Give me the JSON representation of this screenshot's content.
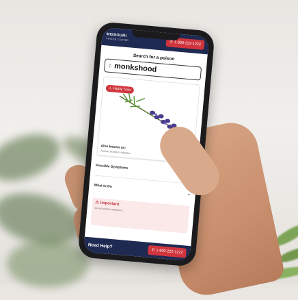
{
  "header": {
    "logo_text": "MISSOURI",
    "logo_sub": "POISON CENTER",
    "phone_label": "1-800-222-1222"
  },
  "search": {
    "title": "Search for a poison",
    "query": "monkshood"
  },
  "result": {
    "badge": "Highly Toxic",
    "also_known_as_label": "Also known as:",
    "also_known_as_value": "Aconite, Aconitum Napellus"
  },
  "sections": [
    {
      "label": "Possible Symptoms"
    },
    {
      "label": "What to Do"
    }
  ],
  "important": {
    "title": "Important",
    "body": "Do not wait for symptoms..."
  },
  "footer": {
    "need_help": "Need Help?",
    "phone_label": "1-800-222-1222"
  },
  "colors": {
    "navy": "#1f2a52",
    "red": "#d0353d",
    "plant_purple": "#4a3e8c"
  },
  "icons": [
    "phone-icon",
    "search-icon",
    "alert-icon",
    "chevron-down-icon"
  ]
}
